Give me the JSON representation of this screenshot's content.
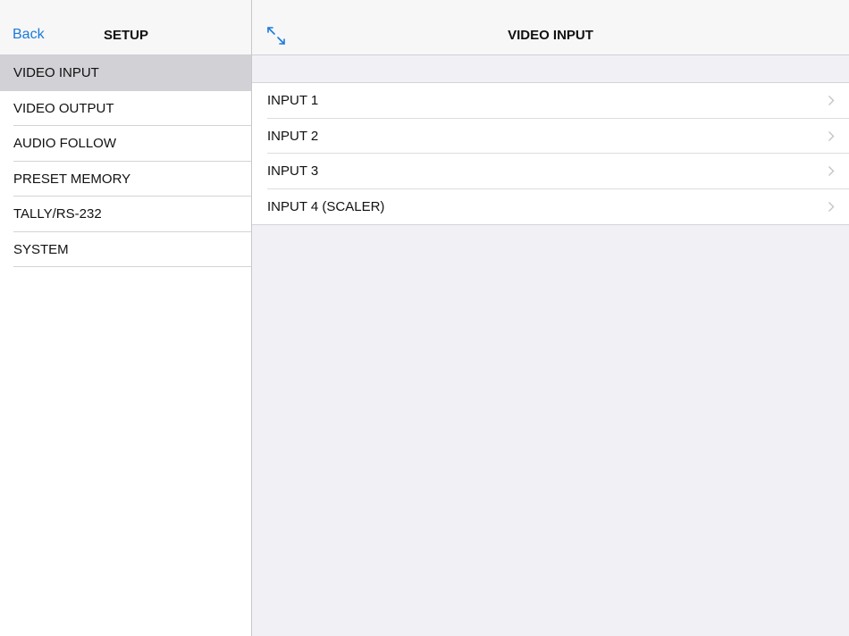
{
  "sidebar": {
    "back_label": "Back",
    "title": "SETUP",
    "items": [
      {
        "label": "VIDEO INPUT",
        "selected": true
      },
      {
        "label": "VIDEO OUTPUT",
        "selected": false
      },
      {
        "label": "AUDIO FOLLOW",
        "selected": false
      },
      {
        "label": "PRESET MEMORY",
        "selected": false
      },
      {
        "label": "TALLY/RS-232",
        "selected": false
      },
      {
        "label": "SYSTEM",
        "selected": false
      }
    ]
  },
  "detail": {
    "title": "VIDEO INPUT",
    "expand_icon": "expand-icon",
    "rows": [
      {
        "label": "INPUT 1"
      },
      {
        "label": "INPUT 2"
      },
      {
        "label": "INPUT 3"
      },
      {
        "label": "INPUT 4 (SCALER)"
      }
    ]
  },
  "colors": {
    "accent": "#1a7ad8",
    "selected_row": "#d1d1d6",
    "background": "#efeff4"
  }
}
